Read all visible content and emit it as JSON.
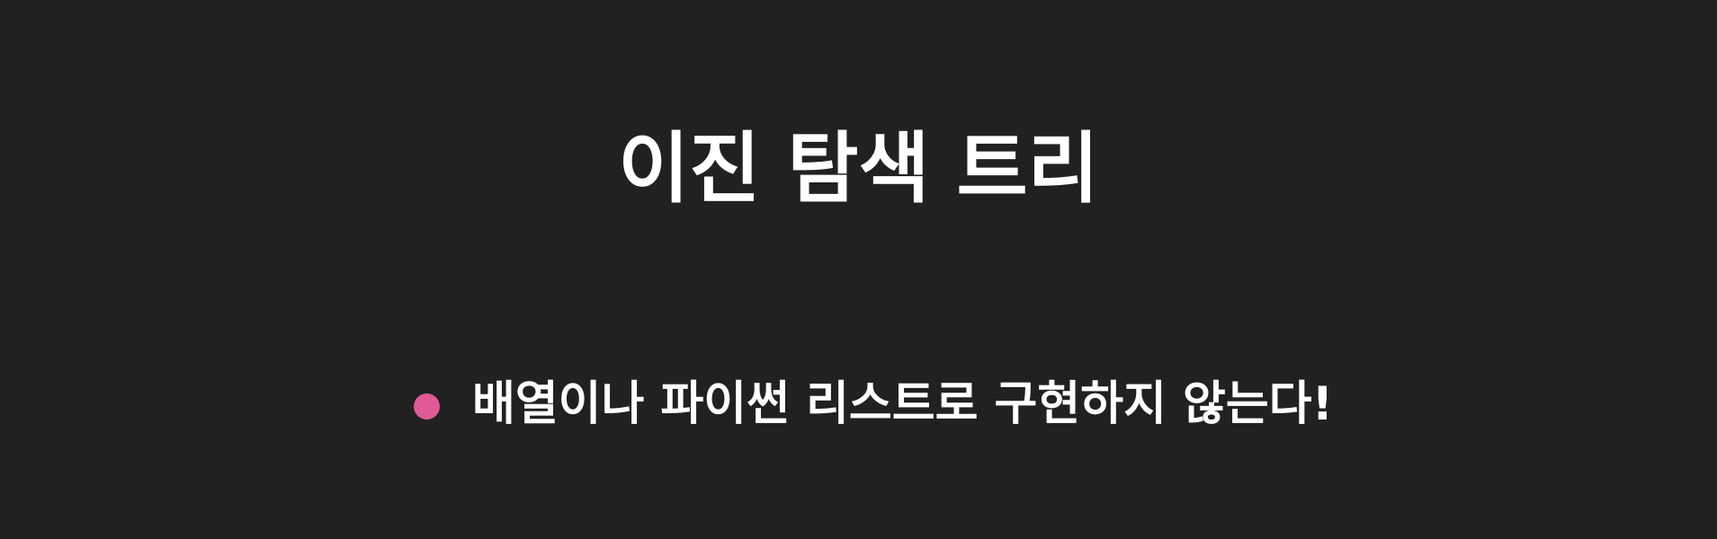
{
  "slide": {
    "title": "이진 탐색 트리",
    "bullets": [
      {
        "text": "배열이나 파이썬 리스트로 구현하지 않는다!"
      }
    ]
  },
  "colors": {
    "background": "#212121",
    "text": "#ffffff",
    "bullet": "#e05a98"
  }
}
